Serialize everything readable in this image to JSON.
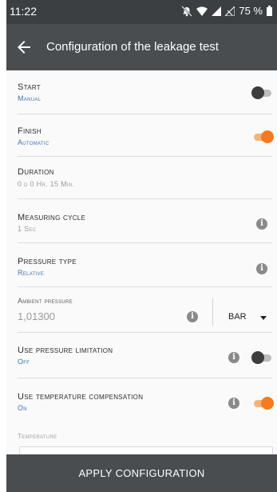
{
  "status_bar": {
    "time": "11:22",
    "battery": "75 %"
  },
  "app_bar": {
    "title": "Configuration of the leakage test"
  },
  "settings": {
    "start": {
      "label": "Start",
      "value": "Manual",
      "toggle_on": false
    },
    "finish": {
      "label": "Finish",
      "value": "Automatic",
      "toggle_on": true
    },
    "duration": {
      "label": "Duration",
      "value": "0 d 0 Hr. 15 Min."
    },
    "measuring_cycle": {
      "label": "Measuring cycle",
      "value": "1 Sec"
    },
    "pressure_type": {
      "label": "Pressure type",
      "value": "Relative"
    },
    "ambient_pressure": {
      "label": "Ambient pressure",
      "value": "1,01300",
      "unit": "BAR"
    },
    "pressure_limitation": {
      "label": "Use pressure limitation",
      "value": "Off",
      "toggle_on": false
    },
    "temperature_compensation": {
      "label": "Use temperature compensation",
      "value": "On",
      "toggle_on": true
    },
    "temperature": {
      "label": "Temperature"
    }
  },
  "actions": {
    "apply_label": "APPLY CONFIGURATION"
  },
  "colors": {
    "accent": "#f47b20",
    "value_text": "#3a73b8",
    "app_bar": "#4a4d50",
    "status_bar": "#3c3f42"
  },
  "icons": {
    "back": "arrow-left-icon",
    "info": "info-icon",
    "dropdown": "caret-down-icon",
    "notifications": "bell-off-icon",
    "wifi": "wifi-icon",
    "signal": "signal-icon",
    "battery": "battery-icon"
  }
}
